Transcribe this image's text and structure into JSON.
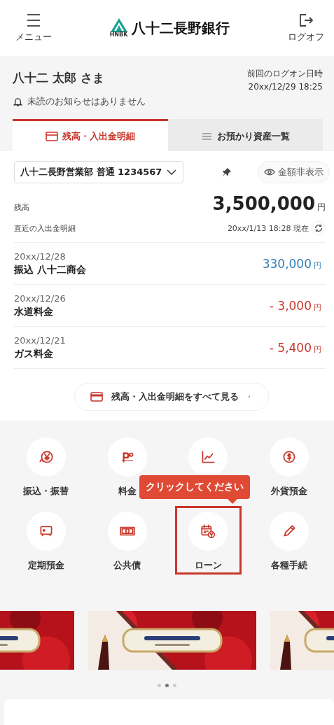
{
  "header": {
    "menu_label": "メニュー",
    "logo_mark": "HNBK",
    "bank_name": "八十二長野銀行",
    "logoff_label": "ログオフ"
  },
  "user": {
    "name": "八十二 太郎 さま",
    "last_logon_label": "前回のログオン日時",
    "last_logon": "20xx/12/29 18:25",
    "notice": "未読のお知らせはありません"
  },
  "tabs": [
    {
      "label": "残高・入出金明細",
      "selected": true
    },
    {
      "label": "お預かり資産一覧",
      "selected": false
    }
  ],
  "account": {
    "selector": "八十二長野営業部 普通 1234567",
    "hide_amounts": "金額非表示",
    "balance_label": "残高",
    "balance": "3,500,000",
    "currency": "円",
    "recent_label": "直近の入出金明細",
    "as_of": "20xx/1/13 18:28 現在"
  },
  "transactions": [
    {
      "date": "20xx/12/28",
      "description": "振込 八十二商会",
      "amount": "330,000",
      "currency": "円",
      "kind": "credit"
    },
    {
      "date": "20xx/12/26",
      "description": "水道料金",
      "amount": "- 3,000",
      "currency": "円",
      "kind": "debit"
    },
    {
      "date": "20xx/12/21",
      "description": "ガス料金",
      "amount": "- 5,400",
      "currency": "円",
      "kind": "debit"
    }
  ],
  "view_all": "残高・入出金明細をすべて見る",
  "menu_items": [
    {
      "kind": "transfer",
      "label": "振込・振替",
      "highlighted": false
    },
    {
      "kind": "payeasy",
      "label": "料金",
      "highlighted": false
    },
    {
      "kind": "chart",
      "highlighted": false
    },
    {
      "kind": "dollar",
      "label": "外貨預金",
      "highlighted": false
    },
    {
      "kind": "safe",
      "label": "定期預金",
      "highlighted": false
    },
    {
      "kind": "bond",
      "label": "公共債",
      "highlighted": false
    },
    {
      "kind": "loan",
      "label": "ローン",
      "highlighted": true
    },
    {
      "kind": "pencil",
      "label": "各種手続",
      "highlighted": false
    }
  ],
  "tooltip": "クリックしてください",
  "carousel_pages": [
    {
      "selected": false
    },
    {
      "selected": true
    },
    {
      "selected": false
    }
  ]
}
